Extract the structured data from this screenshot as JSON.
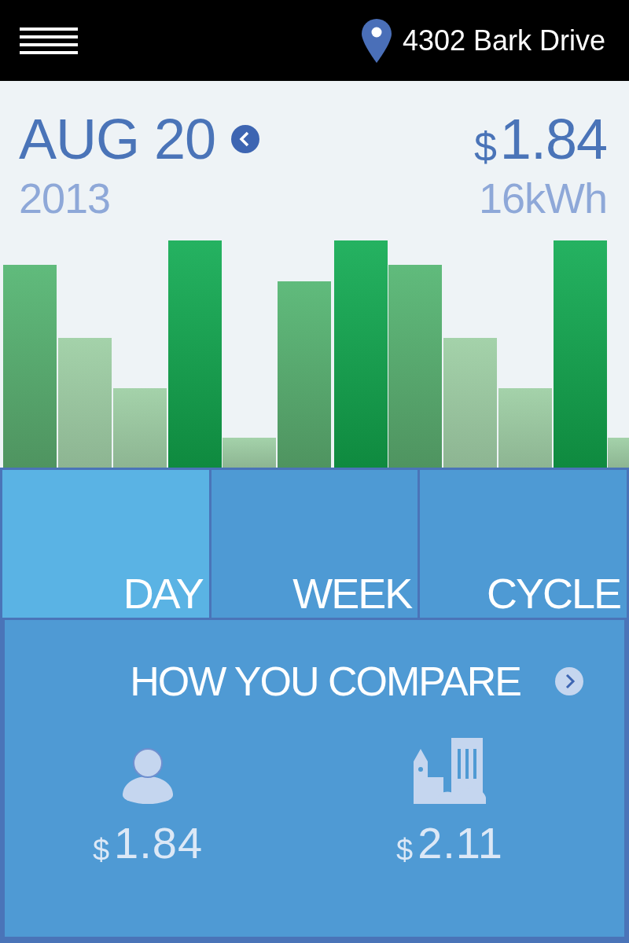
{
  "header": {
    "address": "4302 Bark Drive"
  },
  "summary": {
    "date": "AUG 20",
    "year": "2013",
    "currency": "$",
    "amount": "1.84",
    "usage": "16kWh"
  },
  "tabs": [
    {
      "label": "DAY",
      "selected": true
    },
    {
      "label": "WEEK",
      "selected": false
    },
    {
      "label": "CYCLE",
      "selected": false
    }
  ],
  "compare": {
    "title": "HOW YOU COMPARE",
    "items": [
      {
        "kind": "you",
        "currency": "$",
        "amount": "1.84"
      },
      {
        "kind": "city",
        "currency": "$",
        "amount": "2.11"
      }
    ]
  }
}
